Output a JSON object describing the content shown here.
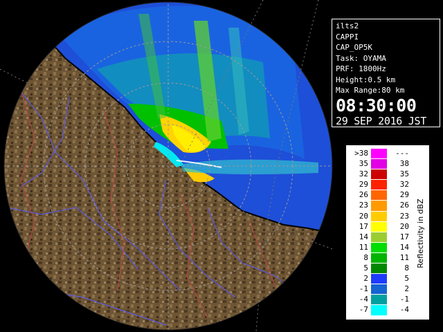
{
  "info": {
    "radar_name": "ilts2",
    "product": "CAPPI",
    "product_code": "CAP_OP5K",
    "task": "Task: OYAMA",
    "prf": "PRF: 1800Hz",
    "height": "Height:0.5 km",
    "max_range": "Max Range:80 km",
    "time": "08:30:00",
    "date": "29 SEP 2016 JST"
  },
  "legend": {
    "unit_label": "Reflectivity in dBZ",
    "rows": [
      {
        "low": ">38",
        "high": "---",
        "color": "#ff00ff"
      },
      {
        "low": "35",
        "high": "38",
        "color": "#e200e6"
      },
      {
        "low": "32",
        "high": "35",
        "color": "#cc0000"
      },
      {
        "low": "29",
        "high": "32",
        "color": "#ff2200"
      },
      {
        "low": "26",
        "high": "29",
        "color": "#ff6600"
      },
      {
        "low": "23",
        "high": "26",
        "color": "#ff9a00"
      },
      {
        "low": "20",
        "high": "23",
        "color": "#ffcc00"
      },
      {
        "low": "17",
        "high": "20",
        "color": "#ffff00"
      },
      {
        "low": "14",
        "high": "17",
        "color": "#9acd32"
      },
      {
        "low": "11",
        "high": "14",
        "color": "#00dd00"
      },
      {
        "low": "8",
        "high": "11",
        "color": "#00b400"
      },
      {
        "low": "5",
        "high": "8",
        "color": "#008800"
      },
      {
        "low": "2",
        "high": "5",
        "color": "#1e3cff"
      },
      {
        "low": "-1",
        "high": "2",
        "color": "#1464d2"
      },
      {
        "low": "-4",
        "high": "-1",
        "color": "#00a0a0"
      },
      {
        "low": "-7",
        "high": "-4",
        "color": "#00ffff"
      }
    ]
  },
  "colors": {
    "background": "#000000",
    "terrain": "#6b5232",
    "coast": "#000000",
    "range_rings": "#a0a0a0",
    "rivers": "#5a5ae0",
    "boundaries": "#c04040"
  }
}
